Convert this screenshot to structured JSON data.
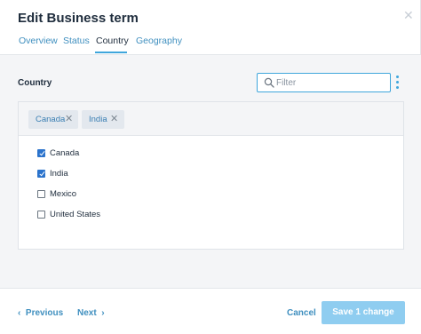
{
  "dialog": {
    "title": "Edit Business term",
    "close_icon": "close-icon"
  },
  "tabs": [
    {
      "label": "Overview",
      "active": false
    },
    {
      "label": "Status",
      "active": false
    },
    {
      "label": "Country",
      "active": true
    },
    {
      "label": "Geography",
      "active": false
    }
  ],
  "section": {
    "label": "Country"
  },
  "filter": {
    "placeholder": "Filter",
    "value": "",
    "icon": "search-icon"
  },
  "selected_chips": [
    {
      "label": "Canada",
      "remove_icon": "close-icon"
    },
    {
      "label": "India",
      "remove_icon": "close-icon"
    }
  ],
  "options": [
    {
      "label": "Canada",
      "checked": true
    },
    {
      "label": "India",
      "checked": true
    },
    {
      "label": "Mexico",
      "checked": false
    },
    {
      "label": "United States",
      "checked": false
    }
  ],
  "footer": {
    "previous_label": "Previous",
    "next_label": "Next",
    "cancel_label": "Cancel",
    "save_label": "Save 1 change"
  },
  "colors": {
    "accent": "#3fa6dc",
    "link": "#3f8fbf",
    "checkbox_checked": "#2b73cc",
    "save_button": "#8fcdf0"
  }
}
